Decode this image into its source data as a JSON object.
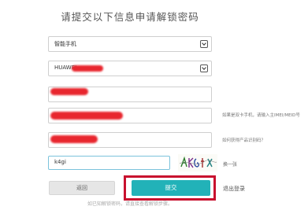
{
  "page_title": "请提交以下信息申请解锁密码",
  "form": {
    "device_type": {
      "value": "智能手机"
    },
    "device_model": {
      "value": "HUAWEI"
    },
    "serial_hint": "如果是双卡手机，请输入主IMEI/MEID号",
    "product_id_hint": "如何获得产品识别码？",
    "captcha_input": {
      "value": "k4gi"
    },
    "captcha_refresh": "换一张"
  },
  "buttons": {
    "back": "返回",
    "submit": "提交",
    "logout": "退出登录"
  },
  "footer_note": "如已知解锁密码，请直接查看解锁步骤。",
  "colors": {
    "submit_bg": "#22b2b8",
    "redaction": "#e8262e",
    "highlight_frame": "#c8102e"
  }
}
